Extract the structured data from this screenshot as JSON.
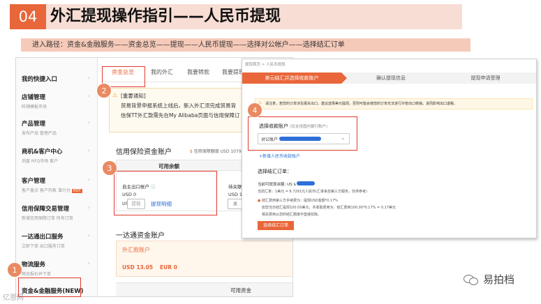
{
  "header": {
    "step_number": "04",
    "title": "外汇提现操作指引——人民币提现",
    "path": "进入路径：资金&金融服务——资金总览——提现——人民币提现——选择对公帐户——选择结汇订单"
  },
  "sidebar": {
    "items": [
      {
        "title": "我的快捷入口",
        "sub": ""
      },
      {
        "title": "店铺管理",
        "sub": "旺铺模板市场"
      },
      {
        "title": "产品管理",
        "sub": "发布产品  管理产品"
      },
      {
        "title": "商机&客户中心",
        "sub": "询盘  RFQ市场  客户"
      },
      {
        "title": "客户管理",
        "sub": "客户盘点  客户列表  潜力分",
        "hot": "HOT"
      },
      {
        "title": "信用保障交易管理",
        "sub": "新增信用保障订单  所有订单"
      },
      {
        "title": "一达通出口服务",
        "sub": "立即下单  出口服务订单"
      },
      {
        "title": "物流服务",
        "sub": "物流报价并下单"
      },
      {
        "title": "资金&金融服务(NEW)",
        "sub": ""
      }
    ]
  },
  "left_main": {
    "tabs": [
      "资金总览",
      "我的外汇",
      "我要转款",
      "我要提现"
    ],
    "notice_title": "[重要通知]",
    "notice_line1": "贸易背景申报系统上线后，新入外汇须完成贸易背",
    "notice_line2": "信保TT外汇款需先在My Alibaba页面与信用保障订",
    "section_title": "信用保险资金账户",
    "credit_limit": "信用保障额度 USD 107999",
    "credit_link": "分",
    "available_header": "可用余额",
    "sub_account_label": "自主出口帐户",
    "sub_account_amount": "USD 0",
    "sub_account_amount2": "USD 0",
    "withdraw_button": "提现",
    "detail_link": "提现明细",
    "pending_label": "待关联",
    "pending_amount": "USD 1",
    "related_button": "关",
    "section2_title": "一达通资金账户",
    "forex_title": "外汇款账户",
    "forex_usd": "USD 13.05",
    "forex_eur": "EUR 0",
    "available_header2": "可用资金"
  },
  "right_panel": {
    "breadcrumb": [
      "提现首页",
      "人民币提现"
    ],
    "steps": [
      "美元结汇并选择收款账户",
      "确认提现信息",
      "提现申请受理"
    ],
    "warning": "请注意，若您的订单涉及报关出口，建议选择美元提现，否则可能会使您的订单无法进行外管出口核销，进而影响出口退税。",
    "account_label": "选择收款账户",
    "account_note": "(仅支持国内银行账户)",
    "account_value": "对公账户",
    "add_account_link": "+新增人民币收款账户",
    "order_label": "选择结汇订单：",
    "balance_label": "当前可提现余额: US $",
    "rate_line": "当前汇率：1美元 = 6.7291元人民币(汇率来自第三方服务，仅供参考)",
    "fee_line1": "结汇费用第三方手续费为：提现USD金额*0.17%",
    "fee_line2": "如您当日结汇提现100.00美元，共收取费用为：结汇费用100.00*0.17% = 0.17美元",
    "fee_line3": "相关费用从您的结汇额度中直接扣除。",
    "order_button": "选择结汇订单"
  },
  "callouts": [
    "1",
    "2",
    "3",
    "4"
  ],
  "watermark": {
    "brand": "易拍档",
    "corner": "亿恩网"
  },
  "colors": {
    "accent": "#e8663a",
    "red": "#e0392c",
    "blue": "#2e6fd8"
  }
}
